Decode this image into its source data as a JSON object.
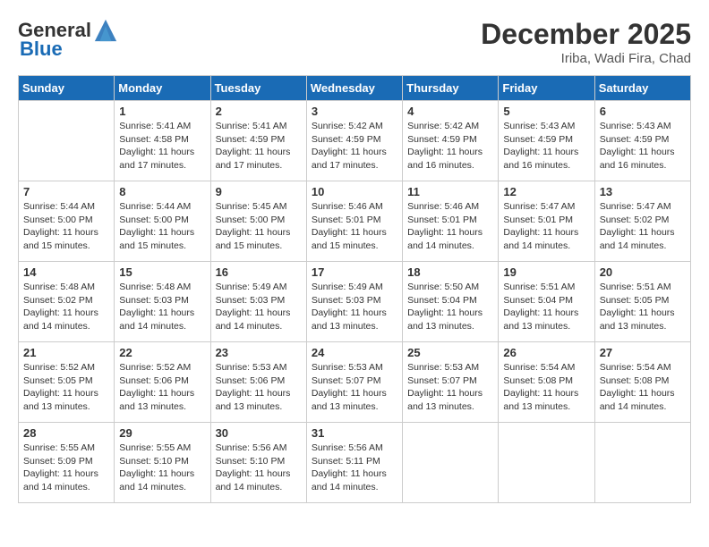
{
  "header": {
    "logo_general": "General",
    "logo_blue": "Blue",
    "month_title": "December 2025",
    "location": "Iriba, Wadi Fira, Chad"
  },
  "weekdays": [
    "Sunday",
    "Monday",
    "Tuesday",
    "Wednesday",
    "Thursday",
    "Friday",
    "Saturday"
  ],
  "weeks": [
    [
      {
        "day": "",
        "sunrise": "",
        "sunset": "",
        "daylight": ""
      },
      {
        "day": "1",
        "sunrise": "Sunrise: 5:41 AM",
        "sunset": "Sunset: 4:58 PM",
        "daylight": "Daylight: 11 hours and 17 minutes."
      },
      {
        "day": "2",
        "sunrise": "Sunrise: 5:41 AM",
        "sunset": "Sunset: 4:59 PM",
        "daylight": "Daylight: 11 hours and 17 minutes."
      },
      {
        "day": "3",
        "sunrise": "Sunrise: 5:42 AM",
        "sunset": "Sunset: 4:59 PM",
        "daylight": "Daylight: 11 hours and 17 minutes."
      },
      {
        "day": "4",
        "sunrise": "Sunrise: 5:42 AM",
        "sunset": "Sunset: 4:59 PM",
        "daylight": "Daylight: 11 hours and 16 minutes."
      },
      {
        "day": "5",
        "sunrise": "Sunrise: 5:43 AM",
        "sunset": "Sunset: 4:59 PM",
        "daylight": "Daylight: 11 hours and 16 minutes."
      },
      {
        "day": "6",
        "sunrise": "Sunrise: 5:43 AM",
        "sunset": "Sunset: 4:59 PM",
        "daylight": "Daylight: 11 hours and 16 minutes."
      }
    ],
    [
      {
        "day": "7",
        "sunrise": "Sunrise: 5:44 AM",
        "sunset": "Sunset: 5:00 PM",
        "daylight": "Daylight: 11 hours and 15 minutes."
      },
      {
        "day": "8",
        "sunrise": "Sunrise: 5:44 AM",
        "sunset": "Sunset: 5:00 PM",
        "daylight": "Daylight: 11 hours and 15 minutes."
      },
      {
        "day": "9",
        "sunrise": "Sunrise: 5:45 AM",
        "sunset": "Sunset: 5:00 PM",
        "daylight": "Daylight: 11 hours and 15 minutes."
      },
      {
        "day": "10",
        "sunrise": "Sunrise: 5:46 AM",
        "sunset": "Sunset: 5:01 PM",
        "daylight": "Daylight: 11 hours and 15 minutes."
      },
      {
        "day": "11",
        "sunrise": "Sunrise: 5:46 AM",
        "sunset": "Sunset: 5:01 PM",
        "daylight": "Daylight: 11 hours and 14 minutes."
      },
      {
        "day": "12",
        "sunrise": "Sunrise: 5:47 AM",
        "sunset": "Sunset: 5:01 PM",
        "daylight": "Daylight: 11 hours and 14 minutes."
      },
      {
        "day": "13",
        "sunrise": "Sunrise: 5:47 AM",
        "sunset": "Sunset: 5:02 PM",
        "daylight": "Daylight: 11 hours and 14 minutes."
      }
    ],
    [
      {
        "day": "14",
        "sunrise": "Sunrise: 5:48 AM",
        "sunset": "Sunset: 5:02 PM",
        "daylight": "Daylight: 11 hours and 14 minutes."
      },
      {
        "day": "15",
        "sunrise": "Sunrise: 5:48 AM",
        "sunset": "Sunset: 5:03 PM",
        "daylight": "Daylight: 11 hours and 14 minutes."
      },
      {
        "day": "16",
        "sunrise": "Sunrise: 5:49 AM",
        "sunset": "Sunset: 5:03 PM",
        "daylight": "Daylight: 11 hours and 14 minutes."
      },
      {
        "day": "17",
        "sunrise": "Sunrise: 5:49 AM",
        "sunset": "Sunset: 5:03 PM",
        "daylight": "Daylight: 11 hours and 13 minutes."
      },
      {
        "day": "18",
        "sunrise": "Sunrise: 5:50 AM",
        "sunset": "Sunset: 5:04 PM",
        "daylight": "Daylight: 11 hours and 13 minutes."
      },
      {
        "day": "19",
        "sunrise": "Sunrise: 5:51 AM",
        "sunset": "Sunset: 5:04 PM",
        "daylight": "Daylight: 11 hours and 13 minutes."
      },
      {
        "day": "20",
        "sunrise": "Sunrise: 5:51 AM",
        "sunset": "Sunset: 5:05 PM",
        "daylight": "Daylight: 11 hours and 13 minutes."
      }
    ],
    [
      {
        "day": "21",
        "sunrise": "Sunrise: 5:52 AM",
        "sunset": "Sunset: 5:05 PM",
        "daylight": "Daylight: 11 hours and 13 minutes."
      },
      {
        "day": "22",
        "sunrise": "Sunrise: 5:52 AM",
        "sunset": "Sunset: 5:06 PM",
        "daylight": "Daylight: 11 hours and 13 minutes."
      },
      {
        "day": "23",
        "sunrise": "Sunrise: 5:53 AM",
        "sunset": "Sunset: 5:06 PM",
        "daylight": "Daylight: 11 hours and 13 minutes."
      },
      {
        "day": "24",
        "sunrise": "Sunrise: 5:53 AM",
        "sunset": "Sunset: 5:07 PM",
        "daylight": "Daylight: 11 hours and 13 minutes."
      },
      {
        "day": "25",
        "sunrise": "Sunrise: 5:53 AM",
        "sunset": "Sunset: 5:07 PM",
        "daylight": "Daylight: 11 hours and 13 minutes."
      },
      {
        "day": "26",
        "sunrise": "Sunrise: 5:54 AM",
        "sunset": "Sunset: 5:08 PM",
        "daylight": "Daylight: 11 hours and 13 minutes."
      },
      {
        "day": "27",
        "sunrise": "Sunrise: 5:54 AM",
        "sunset": "Sunset: 5:08 PM",
        "daylight": "Daylight: 11 hours and 14 minutes."
      }
    ],
    [
      {
        "day": "28",
        "sunrise": "Sunrise: 5:55 AM",
        "sunset": "Sunset: 5:09 PM",
        "daylight": "Daylight: 11 hours and 14 minutes."
      },
      {
        "day": "29",
        "sunrise": "Sunrise: 5:55 AM",
        "sunset": "Sunset: 5:10 PM",
        "daylight": "Daylight: 11 hours and 14 minutes."
      },
      {
        "day": "30",
        "sunrise": "Sunrise: 5:56 AM",
        "sunset": "Sunset: 5:10 PM",
        "daylight": "Daylight: 11 hours and 14 minutes."
      },
      {
        "day": "31",
        "sunrise": "Sunrise: 5:56 AM",
        "sunset": "Sunset: 5:11 PM",
        "daylight": "Daylight: 11 hours and 14 minutes."
      },
      {
        "day": "",
        "sunrise": "",
        "sunset": "",
        "daylight": ""
      },
      {
        "day": "",
        "sunrise": "",
        "sunset": "",
        "daylight": ""
      },
      {
        "day": "",
        "sunrise": "",
        "sunset": "",
        "daylight": ""
      }
    ]
  ]
}
